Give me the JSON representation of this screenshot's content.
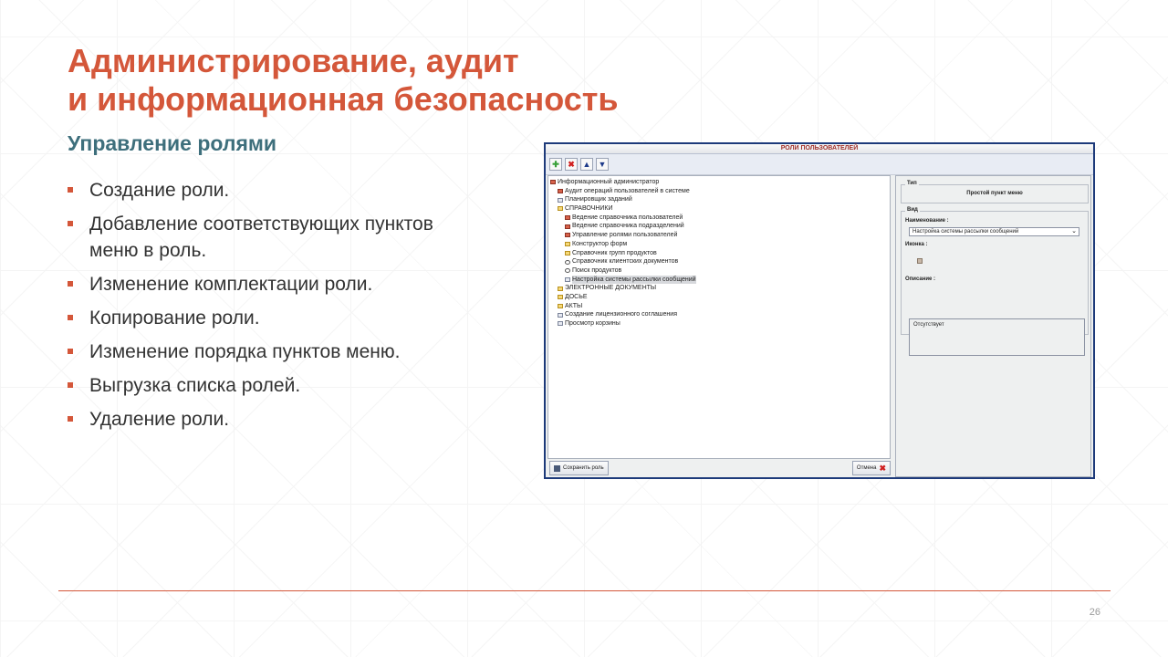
{
  "slide": {
    "title_line1": "Администрирование, аудит",
    "title_line2": "и информационная безопасность",
    "subtitle": "Управление ролями",
    "bullets": [
      "Создание роли.",
      "Добавление соответствующих пунктов меню в роль.",
      "Изменение комплектации роли.",
      "Копирование роли.",
      "Изменение порядка пунктов меню.",
      "Выгрузка списка ролей.",
      "Удаление роли."
    ],
    "page_number": "26",
    "accent_color": "#d4573a",
    "subtitle_color": "#3e6f7c"
  },
  "window": {
    "title": "РОЛИ ПОЛЬЗОВАТЕЛЕЙ",
    "toolbar": {
      "add_icon": "plus-icon",
      "delete_icon": "x-icon",
      "up_icon": "arrow-up-icon",
      "down_icon": "arrow-down-icon"
    },
    "tree": [
      {
        "label": "Информационный администратор",
        "level": 0,
        "icon": "red"
      },
      {
        "label": "Аудит операций пользователей в системе",
        "level": 1,
        "icon": "red"
      },
      {
        "label": "Планировщик заданий",
        "level": 1,
        "icon": "doc"
      },
      {
        "label": "СПРАВОЧНИКИ",
        "level": 1,
        "icon": "folder"
      },
      {
        "label": "Ведение справочника пользователей",
        "level": 2,
        "icon": "red"
      },
      {
        "label": "Ведение справочника подразделений",
        "level": 2,
        "icon": "red"
      },
      {
        "label": "Управление ролями пользователей",
        "level": 2,
        "icon": "red"
      },
      {
        "label": "Конструктор форм",
        "level": 2,
        "icon": "folder"
      },
      {
        "label": "Справочник групп продуктов",
        "level": 2,
        "icon": "folder"
      },
      {
        "label": "Справочник клиентских документов",
        "level": 2,
        "icon": "mag"
      },
      {
        "label": "Поиск продуктов",
        "level": 2,
        "icon": "mag"
      },
      {
        "label": "Настройка системы рассылки сообщений",
        "level": 2,
        "icon": "doc",
        "selected": true
      },
      {
        "label": "ЭЛЕКТРОННЫЕ ДОКУМЕНТЫ",
        "level": 1,
        "icon": "folder"
      },
      {
        "label": "ДОСЬЕ",
        "level": 1,
        "icon": "folder"
      },
      {
        "label": "АКТЫ",
        "level": 1,
        "icon": "folder"
      },
      {
        "label": "Создание лицензионного соглашения",
        "level": 1,
        "icon": "doc"
      },
      {
        "label": "Просмотр корзины",
        "level": 1,
        "icon": "doc"
      }
    ],
    "save_button": "Сохранить роль",
    "cancel_button": "Отмена",
    "type_group": {
      "legend": "Тип",
      "value": "Простой пункт меню"
    },
    "view_group": {
      "legend": "Вид",
      "name_label": "Наименование :",
      "name_value": "Настройка системы рассылки сообщений",
      "icon_label": "Иконка :",
      "description_label": "Описание :",
      "description_value": "Отсутствует"
    }
  }
}
